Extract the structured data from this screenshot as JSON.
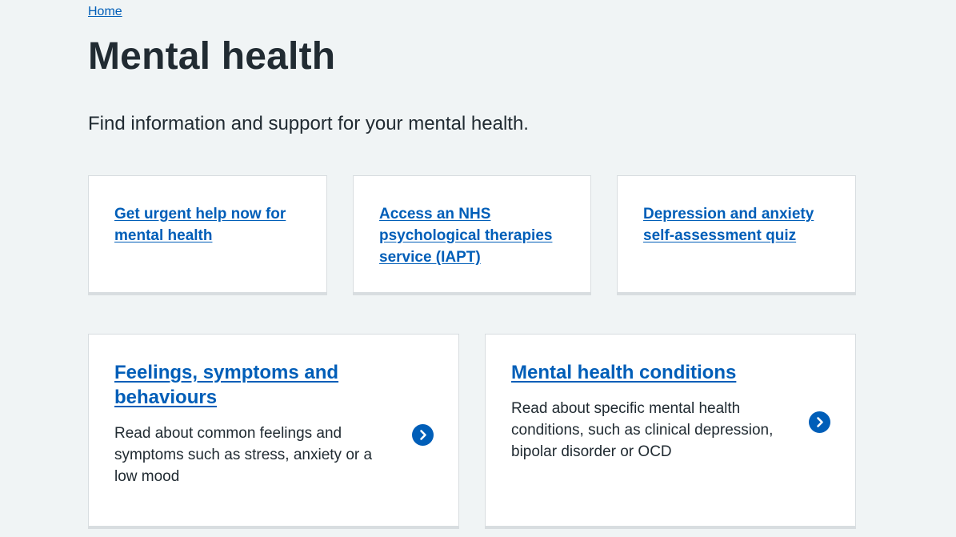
{
  "breadcrumb": {
    "home_label": "Home"
  },
  "header": {
    "title": "Mental health",
    "lede": "Find information and support for your mental health."
  },
  "top_cards": [
    {
      "label": "Get urgent help now for mental health"
    },
    {
      "label": "Access an NHS psychological therapies service (IAPT)"
    },
    {
      "label": "Depression and anxiety self-assessment quiz"
    }
  ],
  "feature_cards": [
    {
      "heading": "Feelings, symptoms and behaviours",
      "description": "Read about common feelings and symptoms such as stress, anxiety or a low mood",
      "icon": "chevron-right-circle-icon"
    },
    {
      "heading": "Mental health conditions",
      "description": "Read about specific mental health conditions, such as clinical depression, bipolar disorder or OCD",
      "icon": "chevron-right-circle-icon"
    }
  ],
  "colors": {
    "background": "#f0f4f5",
    "link": "#005eb8",
    "text": "#212b32",
    "card_border": "#d8dde0",
    "card_background": "#ffffff"
  }
}
